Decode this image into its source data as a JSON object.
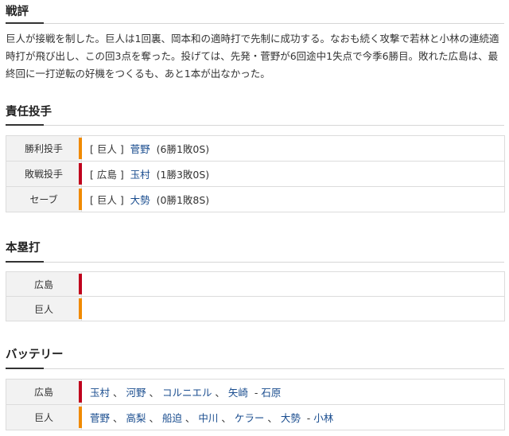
{
  "colors": {
    "giants": "#f08a00",
    "carp": "#c0001d",
    "link": "#1a4d8f"
  },
  "review": {
    "title": "戦評",
    "text": "巨人が接戦を制した。巨人は1回裏、岡本和の適時打で先制に成功する。なおも続く攻撃で若林と小林の連続適時打が飛び出し、この回3点を奪った。投げては、先発・菅野が6回途中1失点で今季6勝目。敗れた広島は、最終回に一打逆転の好機をつくるも、あと1本が出なかった。"
  },
  "pitchers": {
    "title": "責任投手",
    "rows": [
      {
        "label": "勝利投手",
        "team": "[ 巨人 ]",
        "name": "菅野",
        "record": "(6勝1敗0S)",
        "team_color": "giants"
      },
      {
        "label": "敗戦投手",
        "team": "[ 広島 ]",
        "name": "玉村",
        "record": "(1勝3敗0S)",
        "team_color": "carp"
      },
      {
        "label": "セーブ",
        "team": "[ 巨人 ]",
        "name": "大勢",
        "record": "(0勝1敗8S)",
        "team_color": "giants"
      }
    ]
  },
  "homeruns": {
    "title": "本塁打",
    "rows": [
      {
        "label": "広島",
        "value": "",
        "team_color": "carp"
      },
      {
        "label": "巨人",
        "value": "",
        "team_color": "giants"
      }
    ]
  },
  "battery": {
    "title": "バッテリー",
    "rows": [
      {
        "label": "広島",
        "team_color": "carp",
        "pitchers": [
          "玉村",
          "河野",
          "コルニエル",
          "矢崎"
        ],
        "catcher": "石原"
      },
      {
        "label": "巨人",
        "team_color": "giants",
        "pitchers": [
          "菅野",
          "高梨",
          "船迫",
          "中川",
          "ケラー",
          "大勢"
        ],
        "catcher": "小林"
      }
    ]
  }
}
